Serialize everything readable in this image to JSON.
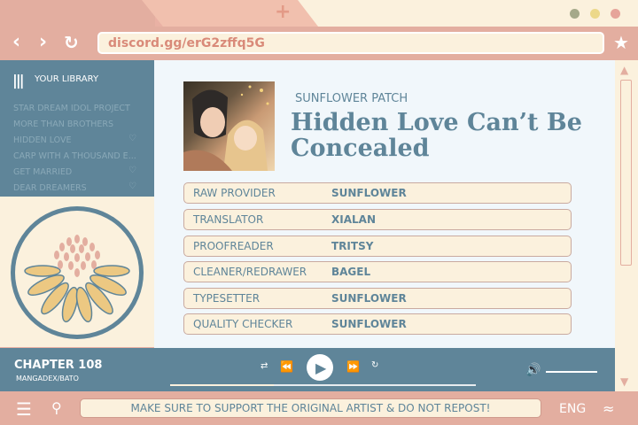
{
  "browser": {
    "url": "discord.gg/erG2zffq5G"
  },
  "library": {
    "header": "YOUR LIBRARY",
    "items": [
      {
        "label": "STAR DREAM IDOL PROJECT",
        "badge": false
      },
      {
        "label": "MORE THAN BROTHERS",
        "badge": false
      },
      {
        "label": "HIDDEN LOVE",
        "badge": true
      },
      {
        "label": "CARP WITH A THOUSAND E...",
        "badge": false
      },
      {
        "label": "GET MARRIED",
        "badge": true
      },
      {
        "label": "DEAR DREAMERS",
        "badge": true
      }
    ]
  },
  "series": {
    "group": "SUNFLOWER PATCH",
    "title": "Hidden Love Can’t Be Concealed"
  },
  "credits": [
    {
      "role": "RAW PROVIDER",
      "name": "SUNFLOWER"
    },
    {
      "role": "TRANSLATOR",
      "name": "XIALAN"
    },
    {
      "role": "PROOFREADER",
      "name": "TRITSY"
    },
    {
      "role": "CLEANER/REDRAWER",
      "name": "BAGEL"
    },
    {
      "role": "TYPESETTER",
      "name": "SUNFLOWER"
    },
    {
      "role": "QUALITY CHECKER",
      "name": "SUNFLOWER"
    }
  ],
  "player": {
    "chapter": "CHAPTER 108",
    "source": "MANGADEX/BATO",
    "progress": 0.34,
    "volume": 1.0
  },
  "footer": {
    "notice": "MAKE SURE TO SUPPORT THE ORIGINAL ARTIST & DO NOT REPOST!",
    "language": "ENG"
  },
  "colors": {
    "accent": "#5f8599",
    "frame": "#e3aea0",
    "cream": "#fbf1dd"
  }
}
